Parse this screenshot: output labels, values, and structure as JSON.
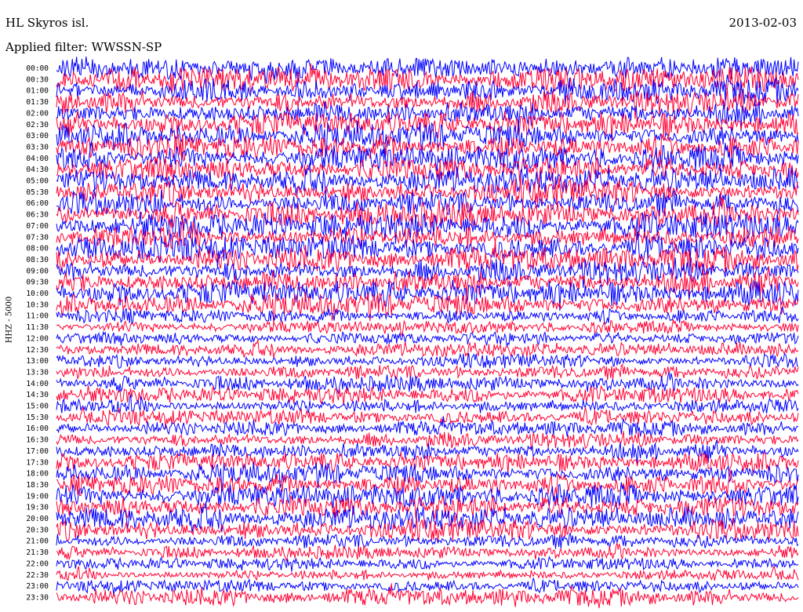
{
  "header": {
    "station": "HL Skyros isl.",
    "date": "2013-02-03",
    "filter": "Applied filter: WWSSN-SP"
  },
  "chart_data": {
    "type": "line",
    "title": "HL Skyros isl.",
    "subtitle": "Applied filter: WWSSN-SP",
    "ylabel": "HHZ - 5000",
    "xlabel": "",
    "colors": [
      "#0000ff",
      "#ff0033"
    ],
    "grid": false,
    "legend": "none",
    "rows": [
      {
        "label": "00:00",
        "amplitude": 0.9
      },
      {
        "label": "00:30",
        "amplitude": 0.95
      },
      {
        "label": "01:00",
        "amplitude": 1.0
      },
      {
        "label": "01:30",
        "amplitude": 1.0
      },
      {
        "label": "02:00",
        "amplitude": 1.0
      },
      {
        "label": "02:30",
        "amplitude": 1.0
      },
      {
        "label": "03:00",
        "amplitude": 1.0
      },
      {
        "label": "03:30",
        "amplitude": 1.0
      },
      {
        "label": "04:00",
        "amplitude": 1.0
      },
      {
        "label": "04:30",
        "amplitude": 1.0
      },
      {
        "label": "05:00",
        "amplitude": 1.0
      },
      {
        "label": "05:30",
        "amplitude": 1.0
      },
      {
        "label": "06:00",
        "amplitude": 1.0
      },
      {
        "label": "06:30",
        "amplitude": 1.0
      },
      {
        "label": "07:00",
        "amplitude": 1.0
      },
      {
        "label": "07:30",
        "amplitude": 1.0
      },
      {
        "label": "08:00",
        "amplitude": 1.0
      },
      {
        "label": "08:30",
        "amplitude": 1.0
      },
      {
        "label": "09:00",
        "amplitude": 1.0
      },
      {
        "label": "09:30",
        "amplitude": 1.0
      },
      {
        "label": "10:00",
        "amplitude": 1.0
      },
      {
        "label": "10:30",
        "amplitude": 0.9
      },
      {
        "label": "11:00",
        "amplitude": 0.55
      },
      {
        "label": "11:30",
        "amplitude": 0.5
      },
      {
        "label": "12:00",
        "amplitude": 0.5
      },
      {
        "label": "12:30",
        "amplitude": 0.55
      },
      {
        "label": "13:00",
        "amplitude": 0.55
      },
      {
        "label": "13:30",
        "amplitude": 0.6
      },
      {
        "label": "14:00",
        "amplitude": 0.6
      },
      {
        "label": "14:30",
        "amplitude": 0.6
      },
      {
        "label": "15:00",
        "amplitude": 0.6
      },
      {
        "label": "15:30",
        "amplitude": 0.6
      },
      {
        "label": "16:00",
        "amplitude": 0.6
      },
      {
        "label": "16:30",
        "amplitude": 0.65
      },
      {
        "label": "17:00",
        "amplitude": 0.7
      },
      {
        "label": "17:30",
        "amplitude": 0.75
      },
      {
        "label": "18:00",
        "amplitude": 0.8
      },
      {
        "label": "18:30",
        "amplitude": 0.85
      },
      {
        "label": "19:00",
        "amplitude": 0.9
      },
      {
        "label": "19:30",
        "amplitude": 0.9
      },
      {
        "label": "20:00",
        "amplitude": 0.9
      },
      {
        "label": "20:30",
        "amplitude": 0.85
      },
      {
        "label": "21:00",
        "amplitude": 0.6
      },
      {
        "label": "21:30",
        "amplitude": 0.5
      },
      {
        "label": "22:00",
        "amplitude": 0.45
      },
      {
        "label": "22:30",
        "amplitude": 0.45
      },
      {
        "label": "23:00",
        "amplitude": 0.5
      },
      {
        "label": "23:30",
        "amplitude": 0.7
      }
    ]
  }
}
